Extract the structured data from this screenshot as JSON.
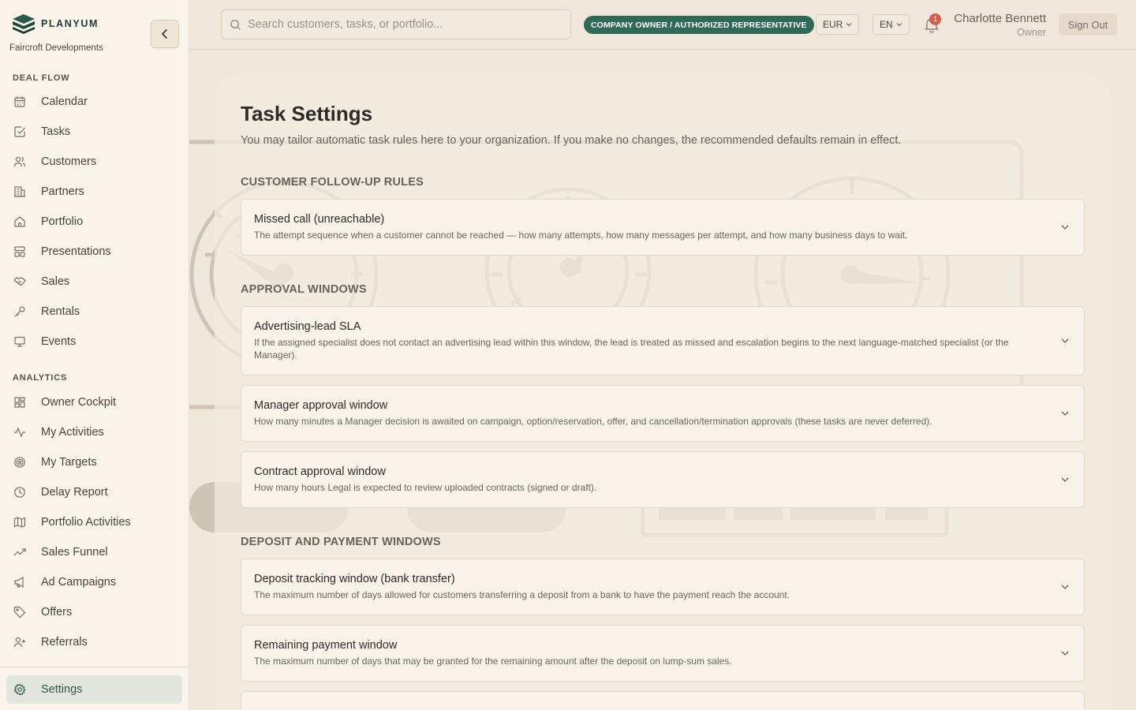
{
  "brand": {
    "name": "PLANYUM",
    "organization": "Faircroft Developments"
  },
  "sidebar": {
    "deal_flow_title": "DEAL FLOW",
    "deal_flow": [
      {
        "label": "Calendar",
        "icon": "calendar-icon"
      },
      {
        "label": "Tasks",
        "icon": "task-check-icon"
      },
      {
        "label": "Customers",
        "icon": "users-icon"
      },
      {
        "label": "Partners",
        "icon": "building-icon"
      },
      {
        "label": "Portfolio",
        "icon": "home-icon"
      },
      {
        "label": "Presentations",
        "icon": "layout-icon"
      },
      {
        "label": "Sales",
        "icon": "handshake-icon"
      },
      {
        "label": "Rentals",
        "icon": "key-icon"
      },
      {
        "label": "Events",
        "icon": "monitor-icon"
      }
    ],
    "analytics_title": "ANALYTICS",
    "analytics": [
      {
        "label": "Owner Cockpit",
        "icon": "grid-icon"
      },
      {
        "label": "My Activities",
        "icon": "activity-icon"
      },
      {
        "label": "My Targets",
        "icon": "target-icon"
      },
      {
        "label": "Delay Report",
        "icon": "clock-icon"
      },
      {
        "label": "Portfolio Activities",
        "icon": "map-icon"
      },
      {
        "label": "Sales Funnel",
        "icon": "trend-icon"
      },
      {
        "label": "Ad Campaigns",
        "icon": "megaphone-icon"
      },
      {
        "label": "Offers",
        "icon": "tag-icon"
      },
      {
        "label": "Referrals",
        "icon": "user-plus-icon"
      }
    ],
    "settings": {
      "label": "Settings",
      "icon": "gear-icon",
      "active": true
    }
  },
  "header": {
    "search_placeholder": "Search customers, tasks, or portfolio...",
    "role_badge": "COMPANY OWNER / AUTHORIZED REPRESENTATIVE",
    "currency": "EUR",
    "language": "EN",
    "notification_count": "1",
    "user_name": "Charlotte Bennett",
    "user_role": "Owner",
    "sign_out": "Sign Out"
  },
  "page": {
    "title": "Task Settings",
    "subtitle": "You may tailor automatic task rules here to your organization. If you make no changes, the recommended defaults remain in effect.",
    "groups": [
      {
        "title": "CUSTOMER FOLLOW-UP RULES",
        "cards": [
          {
            "title": "Missed call (unreachable)",
            "desc": "The attempt sequence when a customer cannot be reached — how many attempts, how many messages per attempt, and how many business days to wait."
          }
        ]
      },
      {
        "title": "APPROVAL WINDOWS",
        "cards": [
          {
            "title": "Advertising-lead SLA",
            "desc": "If the assigned specialist does not contact an advertising lead within this window, the lead is treated as missed and escalation begins to the next language-matched specialist (or the Manager)."
          },
          {
            "title": "Manager approval window",
            "desc": "How many minutes a Manager decision is awaited on campaign, option/reservation, offer, and cancellation/termination approvals (these tasks are never deferred)."
          },
          {
            "title": "Contract approval window",
            "desc": "How many hours Legal is expected to review uploaded contracts (signed or draft)."
          }
        ]
      },
      {
        "title": "DEPOSIT AND PAYMENT WINDOWS",
        "cards": [
          {
            "title": "Deposit tracking window (bank transfer)",
            "desc": "The maximum number of days allowed for customers transferring a deposit from a bank to have the payment reach the account."
          },
          {
            "title": "Remaining payment window",
            "desc": "The maximum number of days that may be granted for the remaining amount after the deposit on lump-sum sales."
          },
          {
            "title": "",
            "desc": ""
          }
        ]
      }
    ]
  },
  "colors": {
    "accent": "#2f6a57",
    "background": "#f1e8dc",
    "sidebar": "#fbf4ea",
    "badge": "#d15f4c"
  }
}
